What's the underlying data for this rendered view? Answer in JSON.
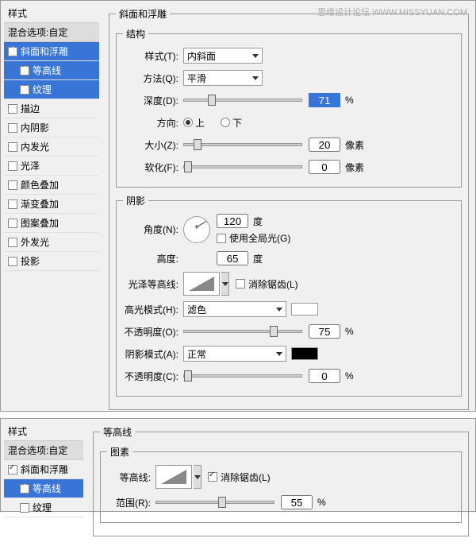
{
  "watermark": {
    "text1": "思缘设计论坛",
    "text2": "WWW.MISSYUAN.COM"
  },
  "sidebar": {
    "title": "样式",
    "blend": "混合选项:自定",
    "items": [
      {
        "label": "斜面和浮雕",
        "checked": true,
        "selected": true
      },
      {
        "label": "等高线",
        "checked": true,
        "sub": true,
        "selected": true
      },
      {
        "label": "纹理",
        "checked": false,
        "sub": true,
        "selected": true
      },
      {
        "label": "描边",
        "checked": false
      },
      {
        "label": "内阴影",
        "checked": false
      },
      {
        "label": "内发光",
        "checked": false
      },
      {
        "label": "光泽",
        "checked": false
      },
      {
        "label": "颜色叠加",
        "checked": false
      },
      {
        "label": "渐变叠加",
        "checked": false
      },
      {
        "label": "图案叠加",
        "checked": false
      },
      {
        "label": "外发光",
        "checked": false
      },
      {
        "label": "投影",
        "checked": false
      }
    ]
  },
  "struct": {
    "legend": "斜面和浮雕",
    "sublegend": "结构",
    "style_label": "样式(T):",
    "style_value": "内斜面",
    "method_label": "方法(Q):",
    "method_value": "平滑",
    "depth_label": "深度(D):",
    "depth_value": "71",
    "depth_unit": "%",
    "dir_label": "方向:",
    "up": "上",
    "down": "下",
    "size_label": "大小(Z):",
    "size_value": "20",
    "size_unit": "像素",
    "soften_label": "软化(F):",
    "soften_value": "0",
    "soften_unit": "像素"
  },
  "shadow": {
    "legend": "阴影",
    "angle_label": "角度(N):",
    "angle_value": "120",
    "angle_unit": "度",
    "global_label": "使用全局光(G)",
    "alt_label": "高度:",
    "alt_value": "65",
    "alt_unit": "度",
    "gloss_label": "光泽等高线:",
    "antialias_label": "消除锯齿(L)",
    "hmode_label": "高光模式(H):",
    "hmode_value": "滤色",
    "hopacity_label": "不透明度(O):",
    "hopacity_value": "75",
    "hopacity_unit": "%",
    "smode_label": "阴影模式(A):",
    "smode_value": "正常",
    "sopacity_label": "不透明度(C):",
    "sopacity_value": "0",
    "sopacity_unit": "%"
  },
  "panel2": {
    "sidebar": {
      "title": "样式",
      "blend": "混合选项:自定",
      "items": [
        {
          "label": "斜面和浮雕",
          "checked": true
        },
        {
          "label": "等高线",
          "checked": true,
          "sub": true,
          "selected": true
        },
        {
          "label": "纹理",
          "checked": false,
          "sub": true
        }
      ]
    },
    "legend": "等高线",
    "sublegend": "图素",
    "contour_label": "等高线:",
    "antialias_label": "消除锯齿(L)",
    "range_label": "范围(R):",
    "range_value": "55",
    "range_unit": "%"
  }
}
